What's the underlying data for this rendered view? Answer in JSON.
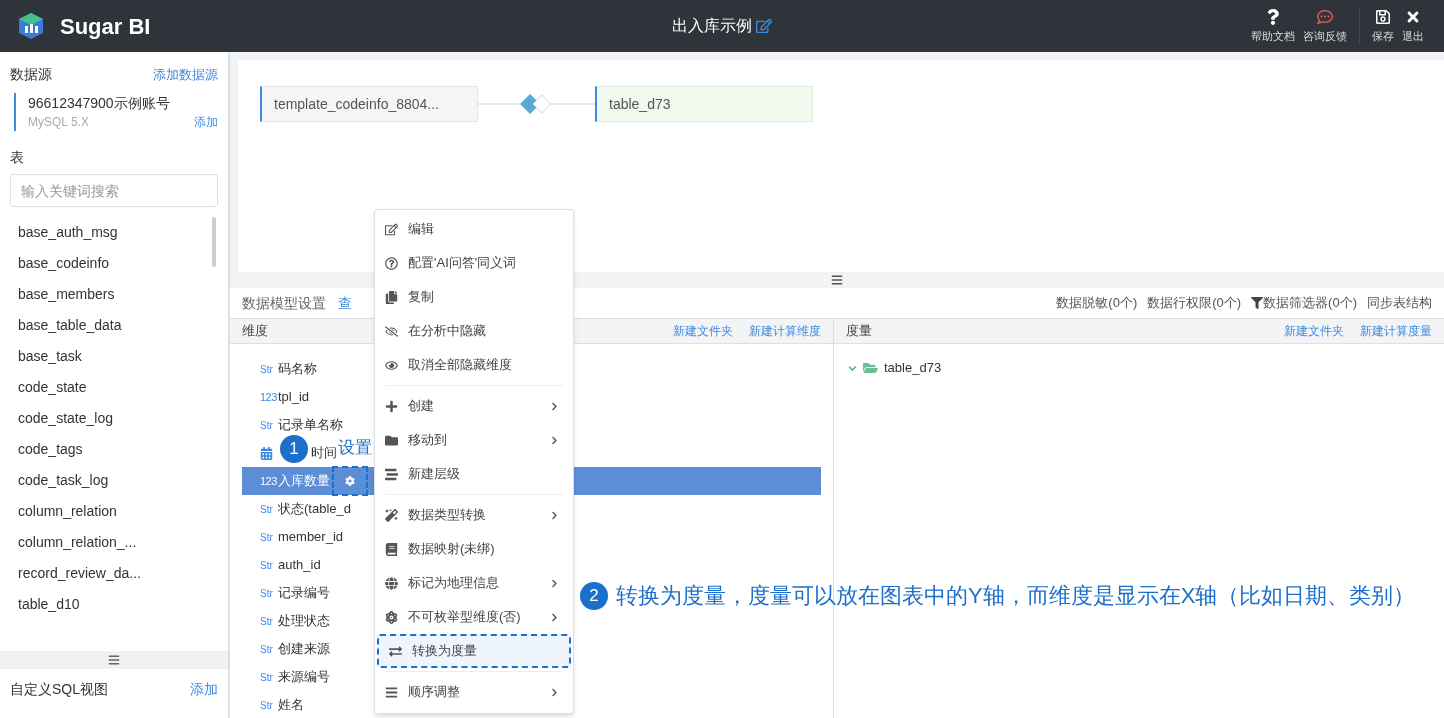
{
  "header": {
    "brand": "Sugar BI",
    "title": "出入库示例",
    "actions": [
      {
        "label": "帮助文档",
        "color": "#ffffff"
      },
      {
        "label": "咨询反馈",
        "color": "#e0584f"
      },
      {
        "label": "保存",
        "color": "#ffffff"
      },
      {
        "label": "退出",
        "color": "#ffffff"
      }
    ]
  },
  "sidebar": {
    "datasource_label": "数据源",
    "add_datasource": "添加数据源",
    "account": {
      "name": "96612347900示例账号",
      "type": "MySQL 5.X",
      "add": "添加"
    },
    "tables_label": "表",
    "search": {
      "placeholder": "输入关键词搜索"
    },
    "tables": [
      "base_auth_msg",
      "base_codeinfo",
      "base_members",
      "base_table_data",
      "base_task",
      "code_state",
      "code_state_log",
      "code_tags",
      "code_task_log",
      "column_relation",
      "column_relation_...",
      "record_review_da...",
      "table_d10"
    ],
    "sql_view_label": "自定义SQL视图",
    "sql_add": "添加"
  },
  "canvas": {
    "nodes": [
      {
        "name": "template_codeinfo_8804...",
        "kind": "source"
      },
      {
        "name": "table_d73",
        "kind": "joined"
      }
    ]
  },
  "model_bar": {
    "title": "数据模型设置",
    "link": "查",
    "actions": [
      {
        "label": "数据脱敏(0个)",
        "kind": "plain"
      },
      {
        "label": "数据行权限(0个)",
        "kind": "plain"
      },
      {
        "label": "数据筛选器(0个)",
        "kind": "filter"
      },
      {
        "label": "同步表结构",
        "kind": "plain"
      }
    ]
  },
  "dimensions": {
    "title": "维度",
    "actions": [
      "新建文件夹",
      "新建计算维度"
    ],
    "items": [
      {
        "kind": "str",
        "type_label": "Str",
        "name": "码名称",
        "selected": false
      },
      {
        "kind": "num",
        "type_label": "123",
        "name": "tpl_id",
        "selected": false
      },
      {
        "kind": "str",
        "type_label": "Str",
        "name": "记录单名称",
        "selected": false
      },
      {
        "kind": "date",
        "name": "时间",
        "selected": false
      },
      {
        "kind": "num",
        "type_label": "123",
        "name": "入库数量",
        "selected": true
      },
      {
        "kind": "str",
        "type_label": "Str",
        "name": "状态(table_d",
        "selected": false
      },
      {
        "kind": "str",
        "type_label": "Str",
        "name": "member_id",
        "selected": false
      },
      {
        "kind": "str",
        "type_label": "Str",
        "name": "auth_id",
        "selected": false
      },
      {
        "kind": "str",
        "type_label": "Str",
        "name": "记录编号",
        "selected": false
      },
      {
        "kind": "str",
        "type_label": "Str",
        "name": "处理状态",
        "selected": false
      },
      {
        "kind": "str",
        "type_label": "Str",
        "name": "创建来源",
        "selected": false
      },
      {
        "kind": "str",
        "type_label": "Str",
        "name": "来源编号",
        "selected": false
      },
      {
        "kind": "str",
        "type_label": "Str",
        "name": "姓名",
        "selected": false
      }
    ]
  },
  "measures": {
    "title": "度量",
    "actions": [
      "新建文件夹",
      "新建计算度量"
    ],
    "tree": [
      {
        "name": "table_d73",
        "expanded": true
      }
    ]
  },
  "context_menu": {
    "groups": [
      [
        {
          "label": "编辑",
          "submenu": false,
          "highlighted": false
        },
        {
          "label": "配置'AI问答'同义词",
          "submenu": false,
          "highlighted": false
        },
        {
          "label": "复制",
          "submenu": false,
          "highlighted": false
        },
        {
          "label": "在分析中隐藏",
          "submenu": false,
          "highlighted": false
        },
        {
          "label": "取消全部隐藏维度",
          "submenu": false,
          "highlighted": false
        }
      ],
      [
        {
          "label": "创建",
          "submenu": true,
          "highlighted": false
        },
        {
          "label": "移动到",
          "submenu": true,
          "highlighted": false
        },
        {
          "label": "新建层级",
          "submenu": false,
          "highlighted": false
        }
      ],
      [
        {
          "label": "数据类型转换",
          "submenu": true,
          "highlighted": false
        },
        {
          "label": "数据映射(未绑)",
          "submenu": false,
          "highlighted": false
        },
        {
          "label": "标记为地理信息",
          "submenu": true,
          "highlighted": false
        },
        {
          "label": "不可枚举型维度(否)",
          "submenu": true,
          "highlighted": false
        },
        {
          "label": "转换为度量",
          "submenu": false,
          "highlighted": true
        }
      ],
      [
        {
          "label": "顺序调整",
          "submenu": true,
          "highlighted": false
        }
      ]
    ]
  },
  "annotations": [
    {
      "number": "1",
      "text": "设置"
    },
    {
      "number": "2",
      "text": "转换为度量，度量可以放在图表中的Y轴，而维度是显示在X轴（比如日期、类别）"
    }
  ]
}
